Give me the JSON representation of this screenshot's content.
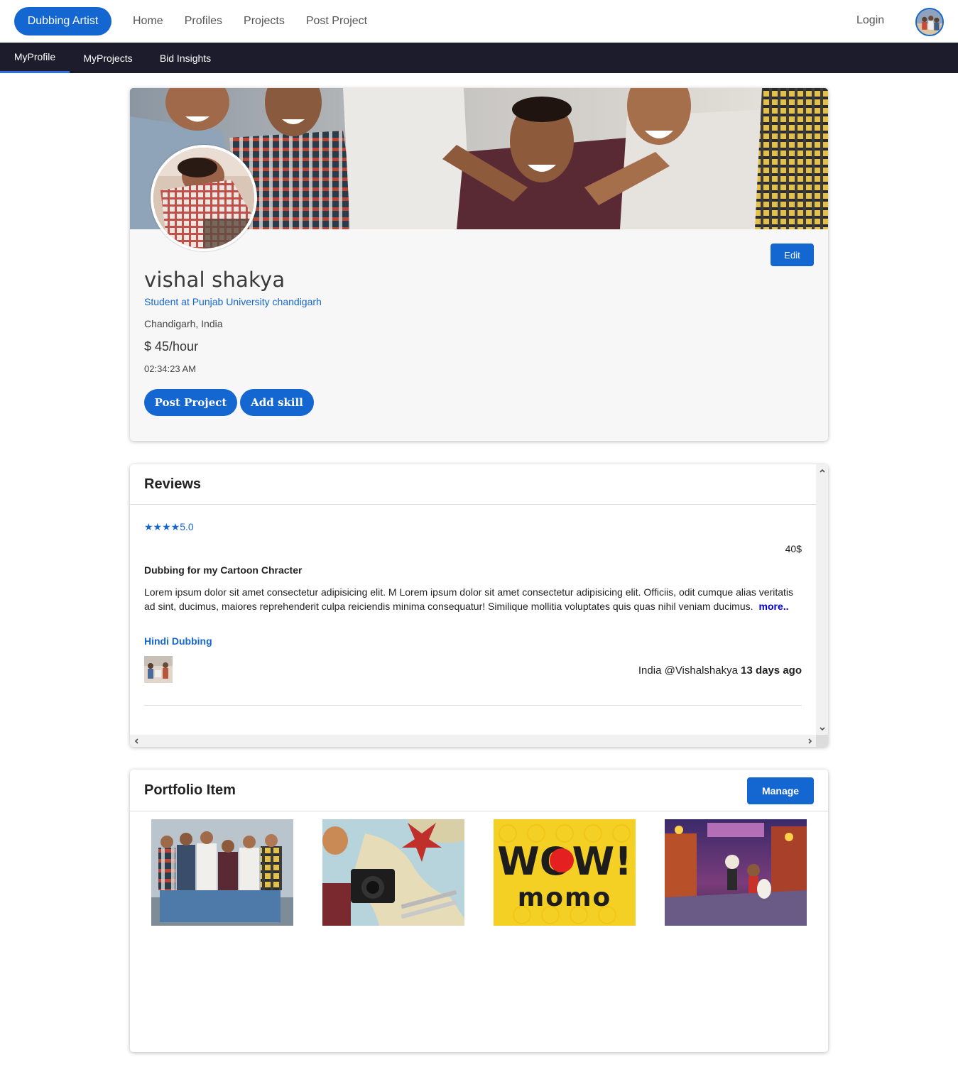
{
  "brand": {
    "label": "Dubbing Artist"
  },
  "nav": {
    "links": [
      "Home",
      "Profiles",
      "Projects",
      "Post Project"
    ],
    "login": "Login"
  },
  "subnav": {
    "tabs": [
      "MyProfile",
      "MyProjects",
      "Bid Insights"
    ],
    "active": "MyProfile"
  },
  "profile": {
    "name": "vishal shakya",
    "headline": "Student at Punjab University chandigarh",
    "location": "Chandigarh, India",
    "rate": "$ 45/hour",
    "local_time": "02:34:23 AM",
    "edit_label": "Edit",
    "post_project_label": "Post Project",
    "add_skill_label": "Add skill"
  },
  "reviews": {
    "title": "Reviews",
    "items": [
      {
        "stars": "★★★★5.0",
        "price": "40$",
        "title": "Dubbing for my Cartoon Chracter",
        "body": "Lorem ipsum dolor sit amet consectetur adipisicing elit. M Lorem ipsum dolor sit amet consectetur adipisicing elit. Officiis, odit cumque alias veritatis ad sint, ducimus, maiores reprehenderit culpa reiciendis minima consequatur! Similique mollitia voluptates quis quas nihil veniam ducimus.",
        "more": "more..",
        "tag": "Hindi Dubbing",
        "country": "India",
        "handle": "@Vishalshakya",
        "ago": "13 days ago"
      }
    ]
  },
  "portfolio": {
    "title": "Portfolio Item",
    "manage_label": "Manage",
    "logo_text_top": "WOW!",
    "logo_text_bottom": "momo"
  },
  "colors": {
    "primary": "#1466d0",
    "subnav_bg": "#1d1c2c",
    "more_link": "#0000cc"
  }
}
